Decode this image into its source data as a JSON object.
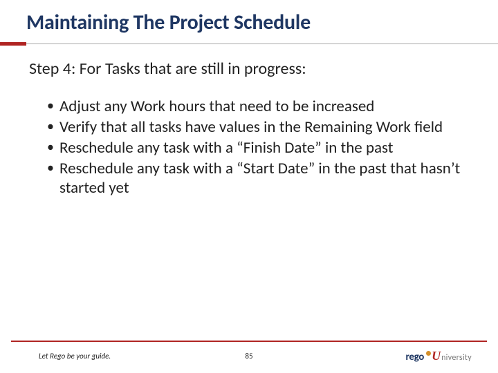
{
  "title": "Maintaining The Project Schedule",
  "step_heading": "Step 4: For Tasks that are still in progress:",
  "bullets": [
    "Adjust any Work hours that need to be increased",
    "Verify that all tasks have values in the Remaining Work field",
    "Reschedule any task with a “Finish Date” in the past",
    "Reschedule any task with a “Start Date” in the past that hasn’t started yet"
  ],
  "footer": {
    "tagline": "Let Rego be your guide.",
    "page_number": "85",
    "logo": {
      "brand": "rego",
      "u": "U",
      "suffix": "niversity"
    }
  }
}
